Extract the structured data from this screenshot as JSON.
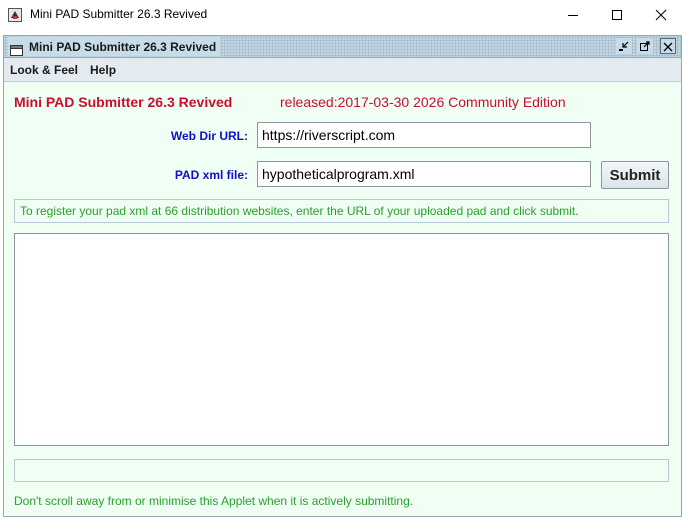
{
  "window": {
    "title": "Mini PAD Submitter 26.3 Revived"
  },
  "internal_frame": {
    "title": "Mini PAD Submitter 26.3 Revived"
  },
  "menubar": {
    "items": [
      {
        "label": "Look & Feel"
      },
      {
        "label": "Help"
      }
    ]
  },
  "header": {
    "app_name": "Mini PAD Submitter 26.3 Revived",
    "release": "released:2017-03-30 2026 Community Edition"
  },
  "form": {
    "web_dir_label": "Web Dir URL:",
    "web_dir_value": "https://riverscript.com",
    "pad_file_label": "PAD xml file:",
    "pad_file_value": "hypotheticalprogram.xml",
    "submit_label": "Submit"
  },
  "info": {
    "text": "To register your pad xml at 66 distribution websites, enter the URL of your uploaded pad and click submit."
  },
  "output": {
    "text": ""
  },
  "status": {
    "text": ""
  },
  "footer": {
    "note": "Don't scroll away from or minimise this Applet when it is actively submitting."
  },
  "colors": {
    "heading_red": "#c8102e",
    "label_blue": "#1010c8",
    "note_green": "#2aa02a",
    "panel_bg": "#f0fff4"
  },
  "icons": [
    "java-app-icon",
    "frame-icon",
    "iconify-icon",
    "maximize-icon",
    "close-icon",
    "minimize-icon",
    "restore-icon"
  ]
}
